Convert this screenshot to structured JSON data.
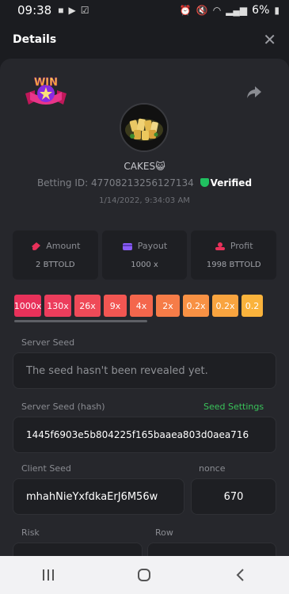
{
  "status_bar": {
    "time": "09:38",
    "battery": "6%"
  },
  "header": {
    "title": "Details"
  },
  "bet": {
    "username": "CAKES😺",
    "betting_id_label": "Betting ID:",
    "betting_id": "4770821325612713​4",
    "verified_label": "Verified",
    "datetime": "1/14/2022, 9:34:03 AM"
  },
  "stats": {
    "amount_label": "Amount",
    "amount_value": "2 BTTOLD",
    "payout_label": "Payout",
    "payout_value": "1000 x",
    "profit_label": "Profit",
    "profit_value": "1998 BTTOLD"
  },
  "multipliers": [
    {
      "label": "1000x",
      "color": "#e8315a"
    },
    {
      "label": "130x",
      "color": "#ec3d5c"
    },
    {
      "label": "26x",
      "color": "#ef4a58"
    },
    {
      "label": "9x",
      "color": "#f25652"
    },
    {
      "label": "4x",
      "color": "#f4664c"
    },
    {
      "label": "2x",
      "color": "#f67c48"
    },
    {
      "label": "0.2x",
      "color": "#f89144"
    },
    {
      "label": "0.2x",
      "color": "#f9a43f"
    },
    {
      "label": "0.2",
      "color": "#fab33c"
    }
  ],
  "server_seed": {
    "label": "Server Seed",
    "placeholder": "The seed hasn't been revealed yet."
  },
  "server_seed_hash": {
    "label": "Server Seed (hash)",
    "link": "Seed Settings",
    "value": "1445f6903e5b804225f165baaea803d0aea716"
  },
  "client_seed": {
    "label": "Client Seed",
    "value": "mhahNieYxfdkaErJ6M56w"
  },
  "nonce": {
    "label": "nonce",
    "value": "670"
  },
  "risk": {
    "label": "Risk"
  },
  "row": {
    "label": "Row"
  }
}
